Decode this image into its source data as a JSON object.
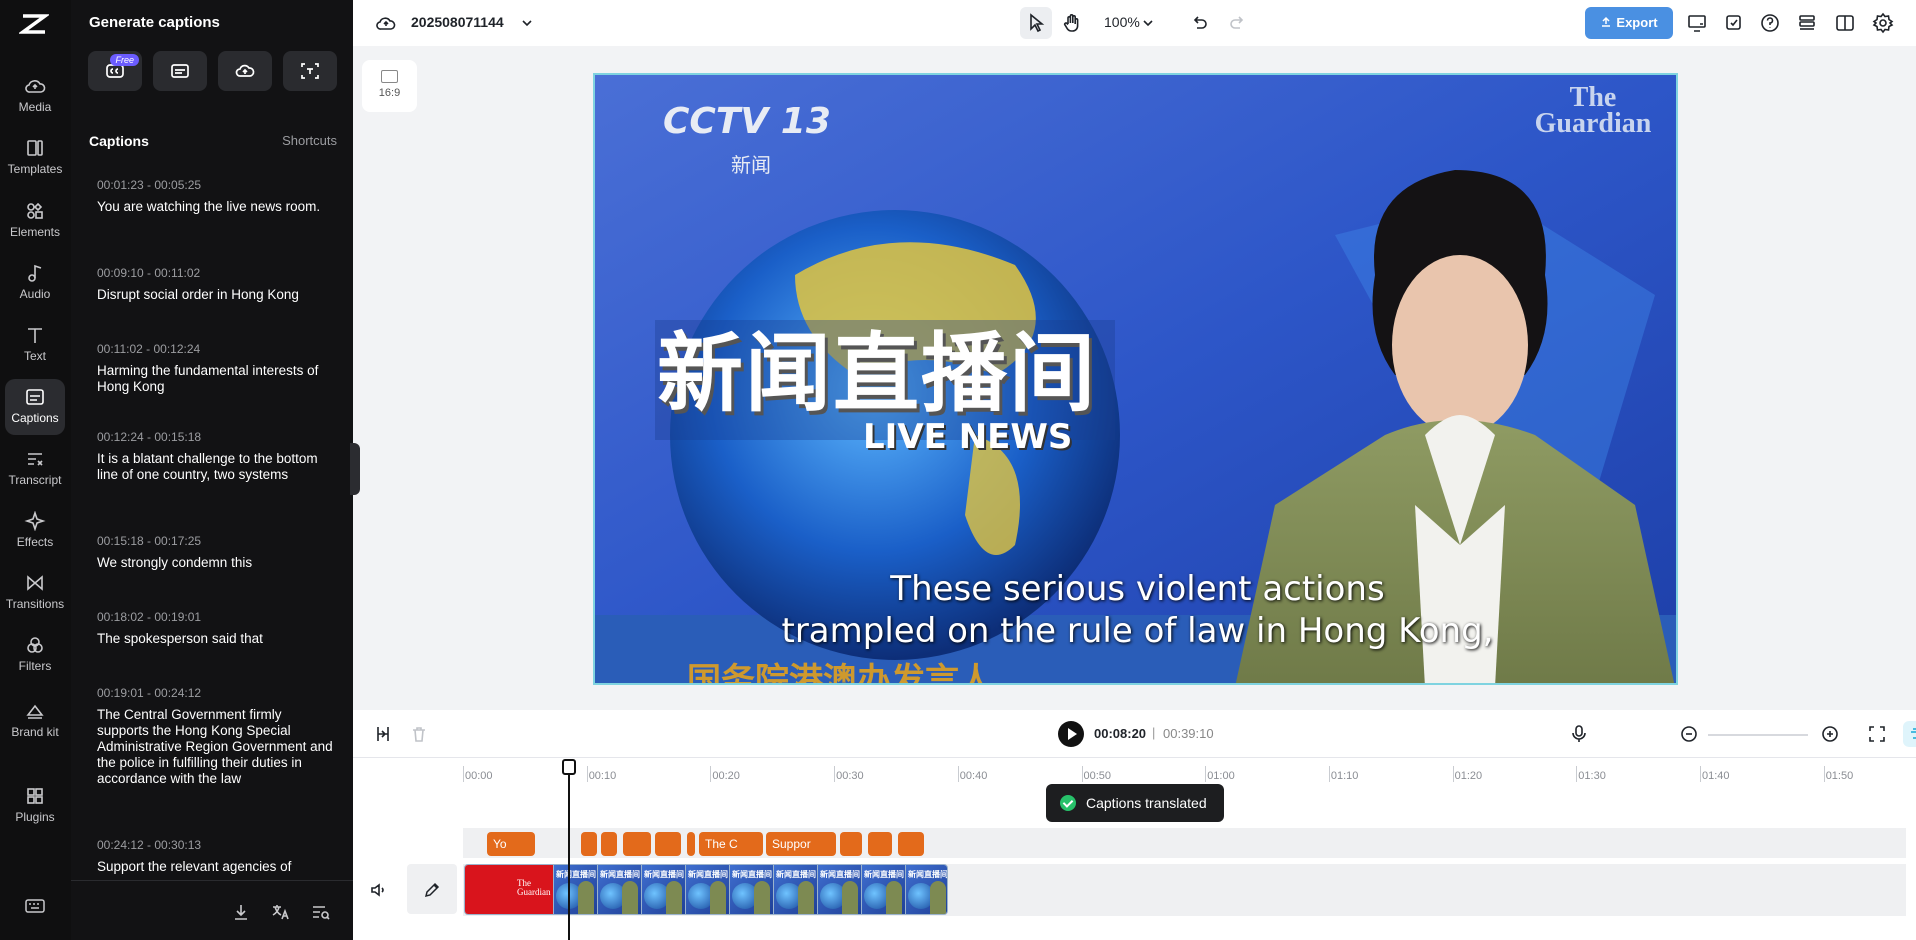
{
  "rail": {
    "items": [
      {
        "label": "Media",
        "icon": "cloud-icon"
      },
      {
        "label": "Templates",
        "icon": "templates-icon"
      },
      {
        "label": "Elements",
        "icon": "elements-icon"
      },
      {
        "label": "Audio",
        "icon": "music-note-icon"
      },
      {
        "label": "Text",
        "icon": "text-icon"
      },
      {
        "label": "Captions",
        "icon": "captions-icon",
        "active": true
      },
      {
        "label": "Transcript",
        "icon": "transcript-icon"
      },
      {
        "label": "Effects",
        "icon": "sparkle-icon"
      },
      {
        "label": "Transitions",
        "icon": "transitions-icon"
      },
      {
        "label": "Filters",
        "icon": "filters-icon"
      },
      {
        "label": "Brand kit",
        "icon": "brand-kit-icon"
      },
      {
        "label": "Plugins",
        "icon": "plugins-icon"
      }
    ]
  },
  "panel": {
    "title": "Generate captions",
    "free_badge": "Free",
    "section_label": "Captions",
    "shortcuts_label": "Shortcuts",
    "captions": [
      {
        "time": "00:01:23 - 00:05:25",
        "text": "You are watching the live news room."
      },
      {
        "time": "00:09:10 - 00:11:02",
        "text": "Disrupt social order in Hong Kong"
      },
      {
        "time": "00:11:02 - 00:12:24",
        "text": "Harming the fundamental interests of Hong Kong"
      },
      {
        "time": "00:12:24 - 00:15:18",
        "text": "It is a blatant challenge to the bottom line of one country, two systems"
      },
      {
        "time": "00:15:18 - 00:17:25",
        "text": "We strongly condemn this"
      },
      {
        "time": "00:18:02 - 00:19:01",
        "text": "The spokesperson said that"
      },
      {
        "time": "00:19:01 - 00:24:12",
        "text": "The Central Government firmly supports the Hong Kong Special Administrative Region Government and the police in fulfilling their duties in accordance with the law"
      },
      {
        "time": "00:24:12 - 00:30:13",
        "text": "Support the relevant agencies of"
      }
    ]
  },
  "topbar": {
    "project_name": "202508071144",
    "zoom": "100%",
    "export_label": "Export"
  },
  "canvas": {
    "ratio_label": "16:9",
    "video": {
      "channel_logo": "CCTV 13",
      "channel_sub": "新闻",
      "watermark": "The Guardian",
      "title_cn": "新闻直播间",
      "title_en": "LIVE NEWS",
      "subtitle_line1": "These serious violent actions",
      "subtitle_line2": "trampled on the rule of law in Hong Kong,",
      "lower_third": "国务院港澳办发言人"
    }
  },
  "playback": {
    "current_time": "00:08:20",
    "separator": "|",
    "total_time": "00:39:10"
  },
  "timeline": {
    "ticks": [
      "00:00",
      "00:10",
      "00:20",
      "00:30",
      "00:40",
      "00:50",
      "01:00",
      "01:10",
      "01:20",
      "01:30",
      "01:40",
      "01:50"
    ],
    "caption_chips": [
      "Yo",
      "",
      "",
      "",
      "",
      "",
      "The C",
      "Suppor",
      "",
      "",
      ""
    ],
    "clip_thumb_logo": "The Guardian",
    "clip_thumb_text": "新闻直播间"
  },
  "toast": {
    "message": "Captions translated"
  },
  "colors": {
    "accent": "#4a90e2",
    "caption_chip": "#e36a1b",
    "rail_bg": "#0f0f10",
    "panel_bg": "#121214"
  }
}
